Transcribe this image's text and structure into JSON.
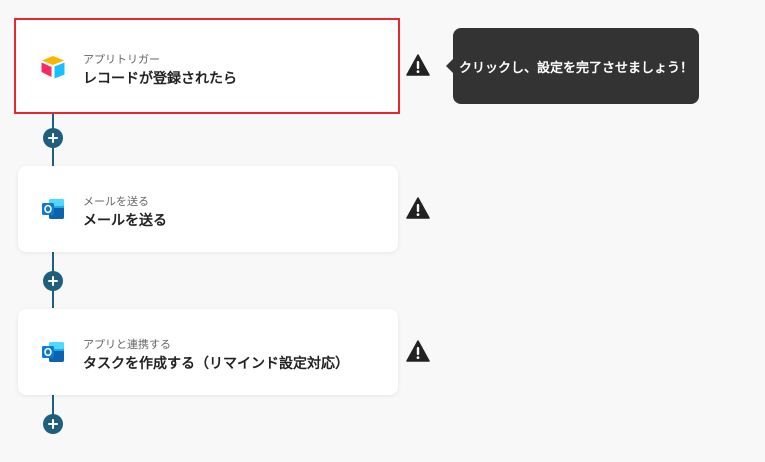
{
  "flow": {
    "steps": [
      {
        "subtitle": "アプリトリガー",
        "title": "レコードが登録されたら",
        "icon": "airtable-icon",
        "selected": true
      },
      {
        "subtitle": "メールを送る",
        "title": "メールを送る",
        "icon": "outlook-icon",
        "selected": false
      },
      {
        "subtitle": "アプリと連携する",
        "title": "タスクを作成する（リマインド設定対応）",
        "icon": "outlook-icon",
        "selected": false
      }
    ]
  },
  "tooltip": {
    "text": "クリックし、設定を完了させましょう！"
  },
  "colors": {
    "accent": "#1f5f7d",
    "selected_border": "#e6292f",
    "tooltip_bg": "#333333",
    "warning": "#222222"
  }
}
